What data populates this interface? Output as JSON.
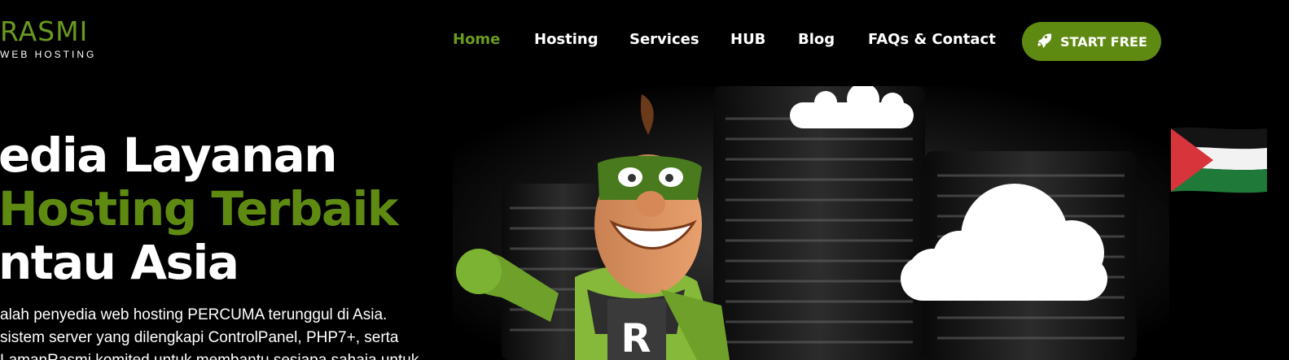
{
  "logo": {
    "name": "RASMI",
    "tagline": "WEB HOSTING"
  },
  "nav": {
    "items": [
      {
        "label": "Home",
        "active": true
      },
      {
        "label": "Hosting",
        "active": false
      },
      {
        "label": "Services",
        "active": false
      },
      {
        "label": "HUB",
        "active": false
      },
      {
        "label": "Blog",
        "active": false
      },
      {
        "label": "FAQs & Contact",
        "active": false
      }
    ],
    "cta_label": "START FREE",
    "cta_icon": "rocket-icon"
  },
  "hero": {
    "title_line1": "edia Layanan",
    "title_line2": "Hosting Terbaik",
    "title_line3": "ntau Asia",
    "desc_line1": "alah penyedia web hosting PERCUMA terunggul di Asia.",
    "desc_line2": "sistem server yang dilengkapi ControlPanel, PHP7+, serta",
    "desc_line3": "LamanRasmi komited untuk membantu sesiapa sahaja untuk"
  },
  "illustration": {
    "mascot_badge_letter": "R",
    "flag": "palestine-flag"
  },
  "colors": {
    "accent": "#5f8a12",
    "background": "#000000",
    "text": "#ffffff"
  }
}
